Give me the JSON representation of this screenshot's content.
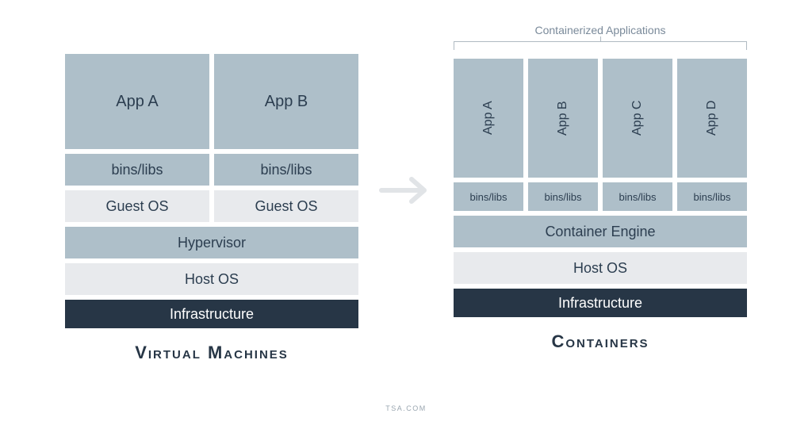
{
  "left": {
    "title": "Virtual Machines",
    "apps": [
      "App A",
      "App B"
    ],
    "binslibs": [
      "bins/libs",
      "bins/libs"
    ],
    "guestos": [
      "Guest OS",
      "Guest OS"
    ],
    "hypervisor": "Hypervisor",
    "hostos": "Host OS",
    "infra": "Infrastructure"
  },
  "right": {
    "caption": "Containerized Applications",
    "title": "Containers",
    "apps": [
      "App A",
      "App B",
      "App C",
      "App D"
    ],
    "binslibs": [
      "bins/libs",
      "bins/libs",
      "bins/libs",
      "bins/libs"
    ],
    "engine": "Container Engine",
    "hostos": "Host OS",
    "infra": "Infrastructure"
  },
  "footer": "TSA.COM"
}
